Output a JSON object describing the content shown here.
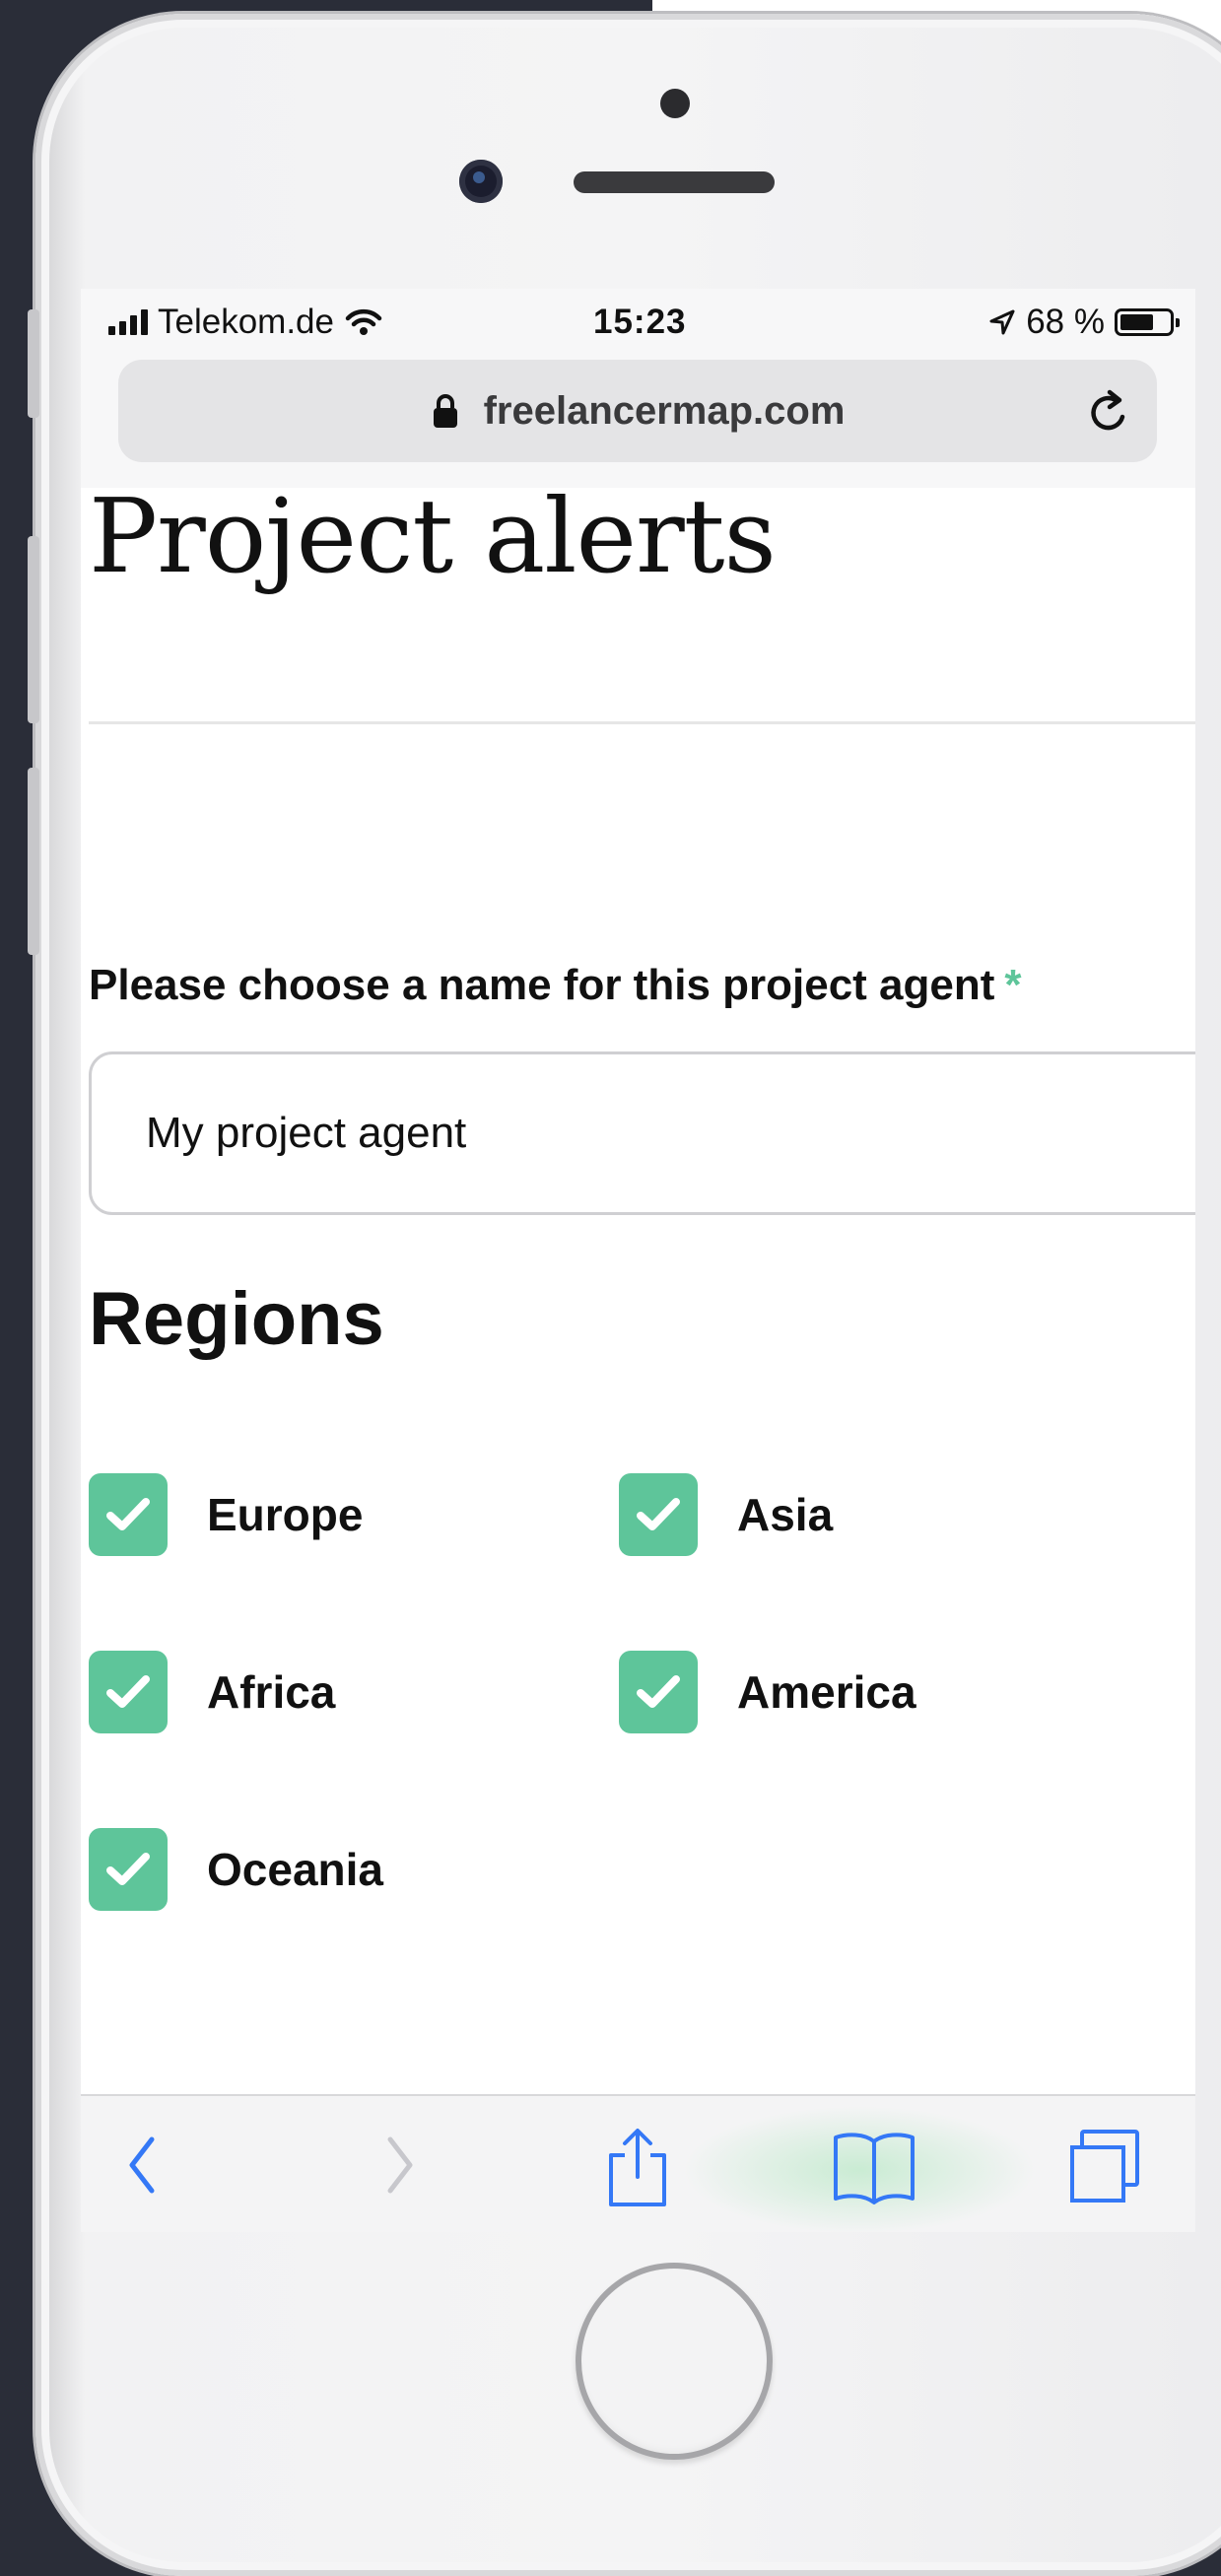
{
  "status_bar": {
    "carrier": "Telekom.de",
    "time": "15:23",
    "battery_text": "68 %",
    "battery_level": 0.68,
    "icons": [
      "signal-icon",
      "wifi-icon",
      "location-arrow-icon",
      "battery-icon"
    ]
  },
  "browser": {
    "url": "freelancermap.com",
    "icons": [
      "lock-icon",
      "reload-icon"
    ]
  },
  "page": {
    "title": "Project alerts",
    "name_field": {
      "label": "Please choose a name for this project agent",
      "required_marker": "*",
      "value": "My project agent"
    },
    "regions": {
      "heading": "Regions",
      "items": [
        {
          "label": "Europe",
          "checked": true
        },
        {
          "label": "Asia",
          "checked": true
        },
        {
          "label": "Africa",
          "checked": true
        },
        {
          "label": "America",
          "checked": true
        },
        {
          "label": "Oceania",
          "checked": true
        }
      ]
    }
  },
  "toolbar": {
    "buttons": [
      "back-icon",
      "forward-icon",
      "share-icon",
      "bookmarks-icon",
      "tabs-icon"
    ]
  },
  "colors": {
    "accent": "#5ec59a",
    "ios_blue": "#3478f6",
    "background_dark": "#2a2d38"
  }
}
